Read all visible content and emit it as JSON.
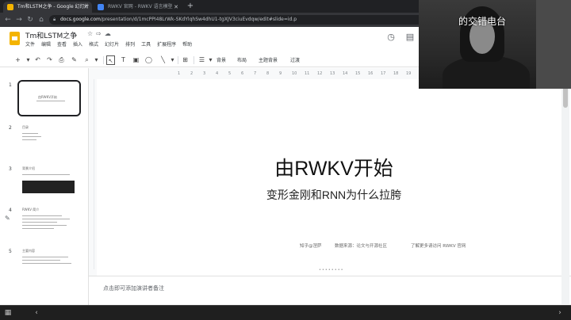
{
  "browser": {
    "tabs": [
      {
        "label": "Tm和LSTM之争 - Google 幻灯片",
        "active": true
      },
      {
        "label": "RWKV 官网 - RWKV 语言模型",
        "active": false
      }
    ],
    "url_host": "docs.google.com",
    "url_path": "/presentation/d/1mcPPI48LrWk-SKdYlqhSw4dhU1-tgXJV3ciuEvdqw/edit#slide=id.p"
  },
  "doc": {
    "title": "Tm和LSTM之争",
    "menu": [
      "文件",
      "编辑",
      "查看",
      "插入",
      "格式",
      "幻灯片",
      "排列",
      "工具",
      "扩展程序",
      "帮助"
    ]
  },
  "toolbar": {
    "background_label": "背景",
    "layout_label": "布局",
    "theme_label": "主题背景",
    "transition_label": "过渡"
  },
  "ruler": [
    "1",
    "2",
    "3",
    "4",
    "5",
    "6",
    "7",
    "8",
    "9",
    "10",
    "11",
    "12",
    "13",
    "14",
    "15",
    "16",
    "17",
    "18",
    "19"
  ],
  "filmstrip": {
    "slides": [
      {
        "num": "1",
        "thumb_text": "由RWKV开始"
      },
      {
        "num": "2",
        "thumb_text": "目录"
      },
      {
        "num": "3",
        "thumb_text": "背景介绍"
      },
      {
        "num": "4",
        "thumb_text": "RWKV 简介"
      },
      {
        "num": "5",
        "thumb_text": "主要内容"
      }
    ]
  },
  "slide": {
    "title": "由RWKV开始",
    "subtitle": "变形金刚和RNN为什么拉胯",
    "credits": [
      "知乎@涅萨",
      "数据来源：论文与开源社区",
      "了解更多请访问 RWKV 官网"
    ],
    "dots": "••••••••"
  },
  "notes": {
    "placeholder": "点击即可添加演讲者备注"
  },
  "webcam": {
    "caption": "的交错电台"
  },
  "colors": {
    "tab_bar": "#202124",
    "slides_logo": "#f4b400",
    "canvas_bg": "#f8f9fa"
  }
}
